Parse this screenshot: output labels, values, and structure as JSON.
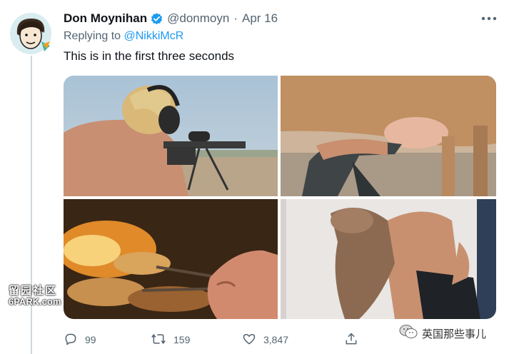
{
  "tweet": {
    "author_name": "Don Moynihan",
    "handle": "@donmoyn",
    "separator": "·",
    "date": "Apr 16",
    "replying_prefix": "Replying to",
    "replying_mention": "@NikkiMcR",
    "text": "This is in the first three seconds"
  },
  "media": {
    "tiles": [
      {
        "description": "shirtless man with ear protection aiming a sniper rifle"
      },
      {
        "description": "man kneeling under a cow milking it"
      },
      {
        "description": "hand turning meat over a fire grill"
      },
      {
        "description": "shirtless man grappling with a calf"
      }
    ]
  },
  "actions": {
    "replies": "99",
    "retweets": "159",
    "likes": "3,847"
  },
  "watermarks": {
    "left_cn": "留园社区",
    "left_en": "6PARK.com",
    "right": "英国那些事儿"
  },
  "colors": {
    "text_primary": "#0f1419",
    "text_secondary": "#536471",
    "link": "#1d9bf0",
    "verified": "#1d9bf0",
    "thread_line": "#cfd9de"
  },
  "icons": [
    "verified-badge-icon",
    "more-icon",
    "reply-icon",
    "retweet-icon",
    "like-icon",
    "share-icon",
    "wechat-icon"
  ]
}
